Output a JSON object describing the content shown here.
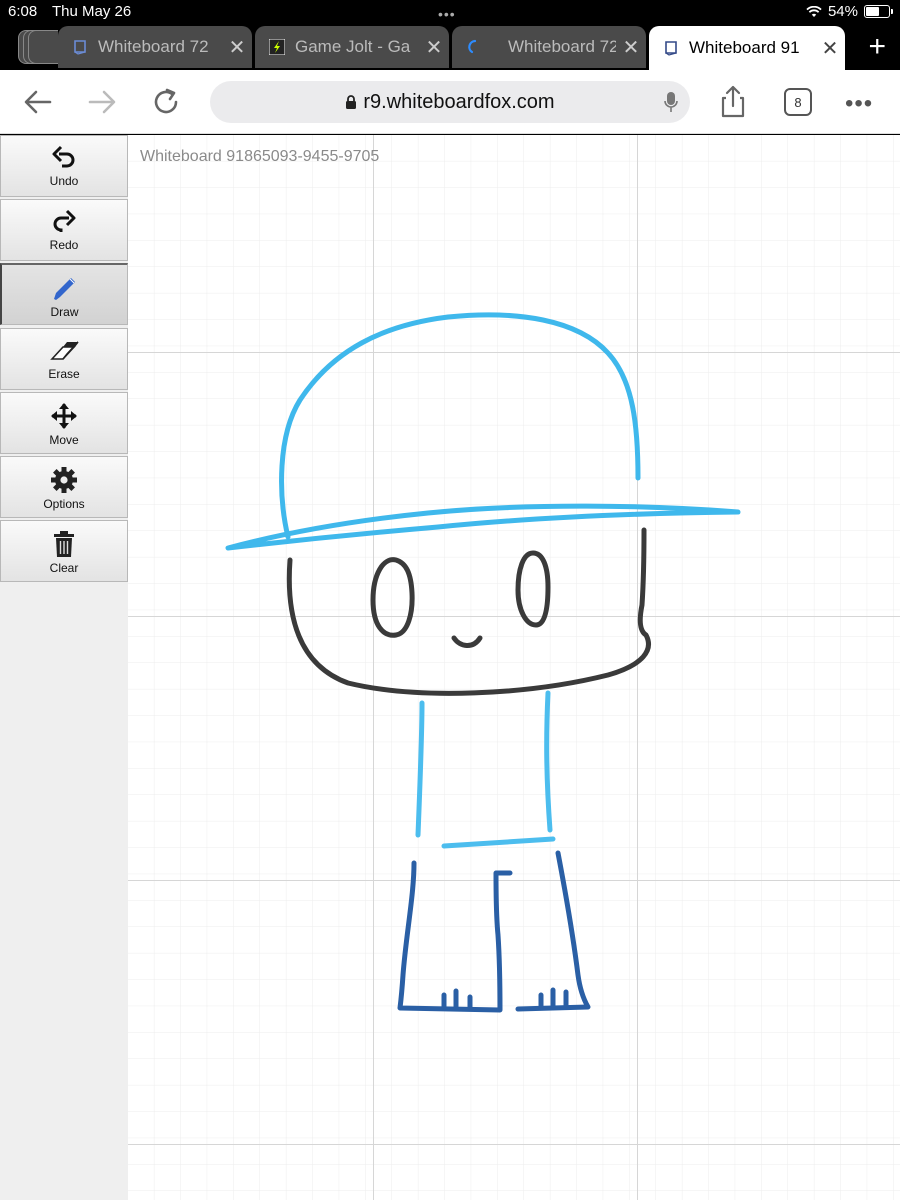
{
  "status_bar": {
    "time": "6:08",
    "date": "Thu May 26",
    "battery": "54%",
    "battery_level": 0.54
  },
  "tabs": [
    {
      "title": "Whiteboard 72",
      "favicon": "whiteboard-fox-icon",
      "active": false
    },
    {
      "title": "Game Jolt - Ga",
      "favicon": "game-jolt-icon",
      "active": false
    },
    {
      "title": "Whiteboard 72",
      "favicon": "loading-spinner-icon",
      "active": false
    },
    {
      "title": "Whiteboard 91",
      "favicon": "whiteboard-fox-icon",
      "active": true
    }
  ],
  "address_bar": {
    "url": "r9.whiteboardfox.com",
    "tab_count": "8"
  },
  "toolbar": {
    "tools": [
      {
        "label": "Undo",
        "icon": "undo-icon",
        "active": false
      },
      {
        "label": "Redo",
        "icon": "redo-icon",
        "active": false
      },
      {
        "label": "Draw",
        "icon": "pencil-icon",
        "active": true
      },
      {
        "label": "Erase",
        "icon": "eraser-icon",
        "active": false
      },
      {
        "label": "Move",
        "icon": "move-icon",
        "active": false
      },
      {
        "label": "Options",
        "icon": "gear-icon",
        "active": false
      },
      {
        "label": "Clear",
        "icon": "trash-icon",
        "active": false
      }
    ]
  },
  "whiteboard": {
    "title": "Whiteboard 91865093-9455-9705",
    "drawing": {
      "colors": {
        "hat": "#3fb8ec",
        "face": "#3a3a3a",
        "neck": "#4cbdee",
        "legs": "#2a5fa5"
      }
    }
  }
}
